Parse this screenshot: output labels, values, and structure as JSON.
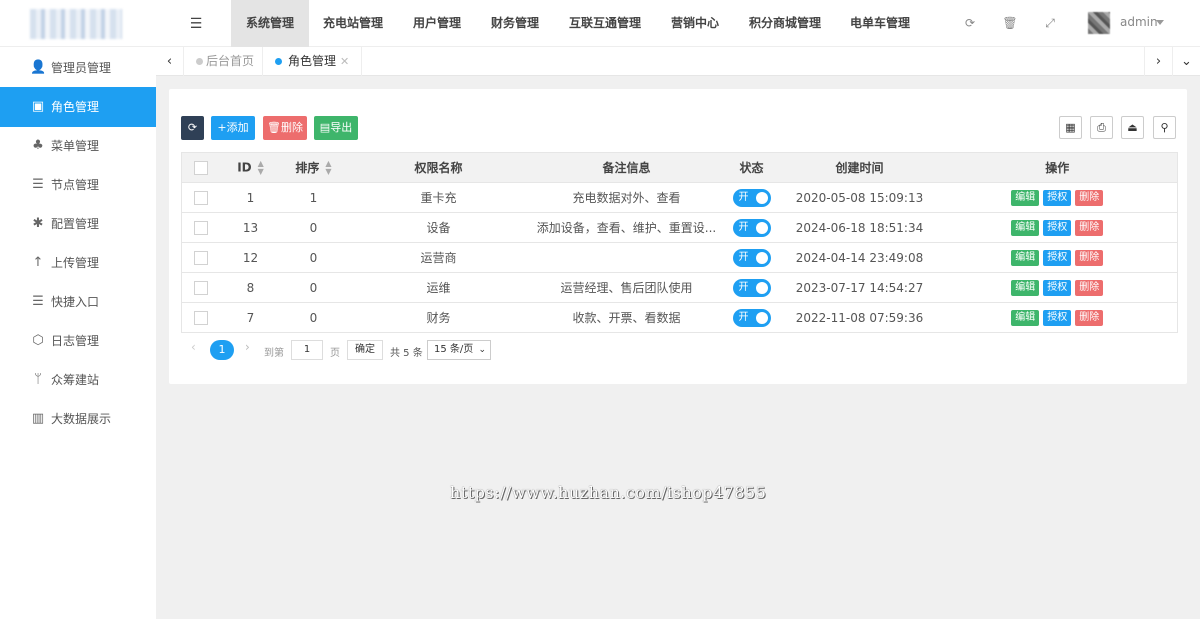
{
  "header": {
    "tabs": [
      {
        "label": "系统管理",
        "active": true
      },
      {
        "label": "充电站管理",
        "active": false
      },
      {
        "label": "用户管理",
        "active": false
      },
      {
        "label": "财务管理",
        "active": false
      },
      {
        "label": "互联互通管理",
        "active": false
      },
      {
        "label": "营销中心",
        "active": false
      },
      {
        "label": "积分商城管理",
        "active": false
      },
      {
        "label": "电单车管理",
        "active": false
      }
    ],
    "icons": [
      "menu-icon",
      "refresh-icon",
      "trash-icon",
      "fullscreen-icon"
    ],
    "username": "admin"
  },
  "sidebar": {
    "items": [
      {
        "label": "管理员管理",
        "icon": "user-icon",
        "glyph": "👤",
        "active": false
      },
      {
        "label": "角色管理",
        "icon": "group-icon",
        "glyph": "▣",
        "active": true
      },
      {
        "label": "菜单管理",
        "icon": "tree-icon",
        "glyph": "♣",
        "active": false
      },
      {
        "label": "节点管理",
        "icon": "list-icon",
        "glyph": "☰",
        "active": false
      },
      {
        "label": "配置管理",
        "icon": "asterisk-icon",
        "glyph": "✱",
        "active": false
      },
      {
        "label": "上传管理",
        "icon": "arrow-up-icon",
        "glyph": "↑",
        "active": false
      },
      {
        "label": "快捷入口",
        "icon": "list-icon",
        "glyph": "☰",
        "active": false
      },
      {
        "label": "日志管理",
        "icon": "hexagon-icon",
        "glyph": "⬡",
        "active": false
      },
      {
        "label": "众筹建站",
        "icon": "branch-icon",
        "glyph": "ᛘ",
        "active": false
      },
      {
        "label": "大数据展示",
        "icon": "bar-chart-icon",
        "glyph": "▥",
        "active": false
      }
    ]
  },
  "tabbar": {
    "tabs": [
      {
        "label": "后台首页",
        "active": false,
        "closable": false
      },
      {
        "label": "角色管理",
        "active": true,
        "closable": true
      }
    ]
  },
  "toolbar": {
    "add_label": "添加",
    "delete_label": "删除",
    "export_label": "导出",
    "colors": {
      "dark": "#2f4056",
      "blue": "#1e9ff2",
      "red": "#ed6d6d",
      "green": "#3eb56b"
    }
  },
  "table": {
    "columns": [
      "ID",
      "排序",
      "权限名称",
      "备注信息",
      "状态",
      "创建时间",
      "操作"
    ],
    "rows": [
      {
        "id": "1",
        "sort": "1",
        "name": "重卡充",
        "remark": "充电数据对外、查看",
        "status": "开",
        "created": "2020-05-08 15:09:13"
      },
      {
        "id": "13",
        "sort": "0",
        "name": "设备",
        "remark": "添加设备，查看、维护、重置设...",
        "status": "开",
        "created": "2024-06-18 18:51:34"
      },
      {
        "id": "12",
        "sort": "0",
        "name": "运营商",
        "remark": "",
        "status": "开",
        "created": "2024-04-14 23:49:08"
      },
      {
        "id": "8",
        "sort": "0",
        "name": "运维",
        "remark": "运营经理、售后团队使用",
        "status": "开",
        "created": "2023-07-17 14:54:27"
      },
      {
        "id": "7",
        "sort": "0",
        "name": "财务",
        "remark": "收款、开票、看数据",
        "status": "开",
        "created": "2022-11-08 07:59:36"
      }
    ],
    "actions": {
      "edit": "编辑",
      "auth": "授权",
      "delete": "删除"
    }
  },
  "pagination": {
    "current": "1",
    "goto_prefix": "到第",
    "goto_value": "1",
    "goto_suffix": "页",
    "confirm": "确定",
    "total": "共 5 条",
    "page_size": "15 条/页"
  },
  "watermark": "https://www.huzhan.com/ishop47855"
}
